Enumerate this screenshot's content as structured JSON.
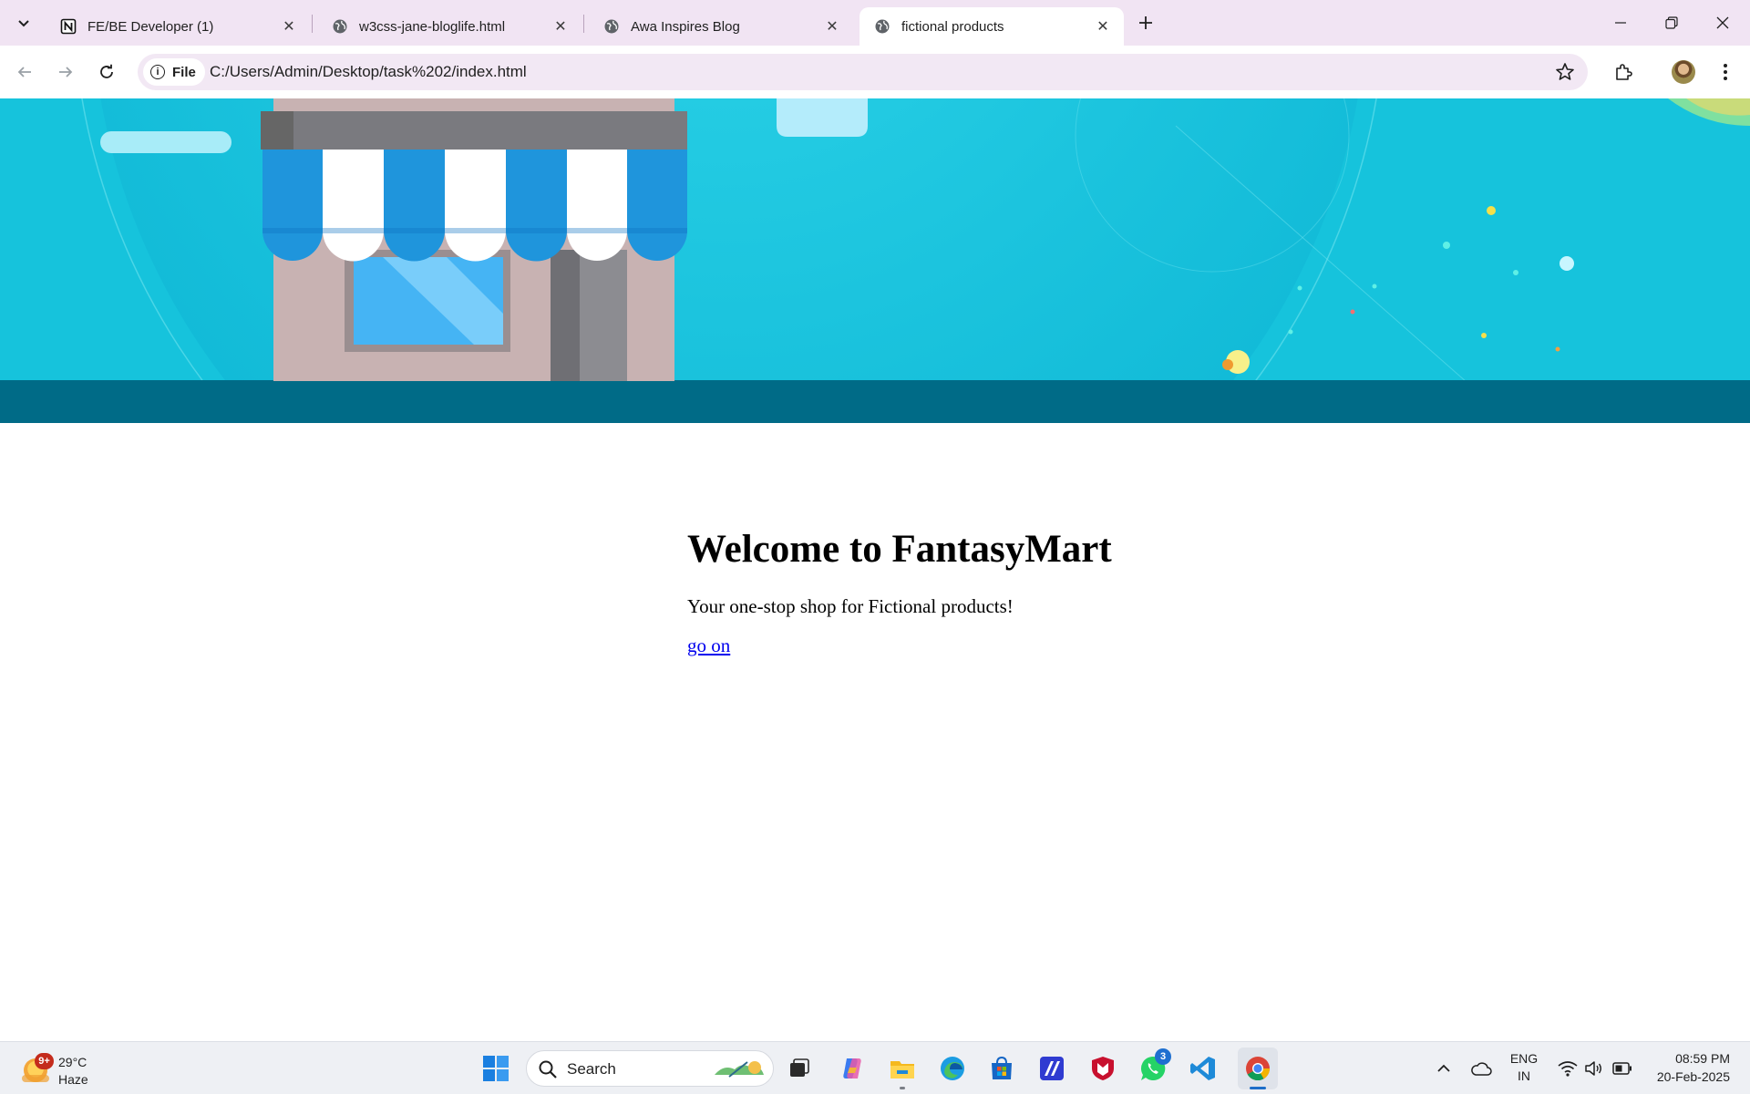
{
  "browser": {
    "tabs": [
      {
        "title": "FE/BE Developer (1)",
        "favicon": "notion-icon"
      },
      {
        "title": "w3css-jane-bloglife.html",
        "favicon": "globe-icon"
      },
      {
        "title": "Awa Inspires Blog",
        "favicon": "globe-icon"
      },
      {
        "title": "fictional products",
        "favicon": "globe-icon",
        "active": true
      }
    ],
    "chip_label": "File",
    "url": "C:/Users/Admin/Desktop/task%202/index.html"
  },
  "page": {
    "heading": "Welcome to FantasyMart",
    "tagline": "Your one-stop shop for Fictional products!",
    "link_text": "go on"
  },
  "taskbar": {
    "weather": {
      "badge": "9+",
      "temp": "29°C",
      "condition": "Haze"
    },
    "search_label": "Search",
    "whatsapp_badge": "3",
    "lang": {
      "line1": "ENG",
      "line2": "IN"
    },
    "clock": {
      "time": "08:59 PM",
      "date": "20-Feb-2025"
    }
  },
  "colors": {
    "tabstrip": "#f1e4f3",
    "omnibox": "#f2e8f4",
    "banner_sky": "#16c3dc",
    "banner_floor": "#006b87",
    "link": "#0000ee",
    "taskbar": "#eef0f4"
  }
}
